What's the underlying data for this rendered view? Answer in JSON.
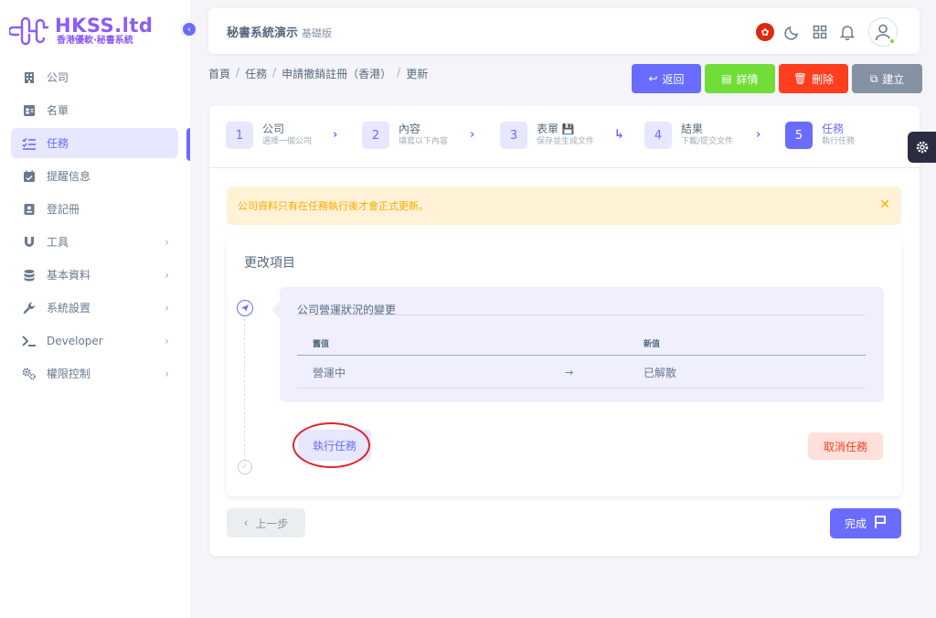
{
  "brand": {
    "name": "HKSS.ltd",
    "subtitle": "香港優軟·秘書系統",
    "accent": "#8b5cf6"
  },
  "sidebar": {
    "items": [
      {
        "label": "公司",
        "icon": "building-icon",
        "has_submenu": false,
        "active": false
      },
      {
        "label": "名單",
        "icon": "contact-card-icon",
        "has_submenu": false,
        "active": false
      },
      {
        "label": "任務",
        "icon": "checklist-icon",
        "has_submenu": false,
        "active": true
      },
      {
        "label": "提醒信息",
        "icon": "calendar-icon",
        "has_submenu": false,
        "active": false
      },
      {
        "label": "登記冊",
        "icon": "register-icon",
        "has_submenu": false,
        "active": false
      },
      {
        "label": "工具",
        "icon": "magnet-icon",
        "has_submenu": true,
        "active": false
      },
      {
        "label": "基本資料",
        "icon": "database-icon",
        "has_submenu": true,
        "active": false
      },
      {
        "label": "系統設置",
        "icon": "wrench-icon",
        "has_submenu": true,
        "active": false
      },
      {
        "label": "Developer",
        "icon": "terminal-icon",
        "has_submenu": true,
        "active": false
      },
      {
        "label": "權限控制",
        "icon": "gears-icon",
        "has_submenu": true,
        "active": false
      }
    ]
  },
  "navbar": {
    "title": "秘書系統演示",
    "edition": "基礎版",
    "flag_symbol": "✿"
  },
  "breadcrumb": [
    "首頁",
    "任務",
    "申請撤銷註冊（香港）",
    "更新"
  ],
  "breadcrumb_sep": "/",
  "actions": {
    "back": "返回",
    "detail": "詳情",
    "delete": "刪除",
    "create": "建立"
  },
  "stepper": {
    "steps": [
      {
        "num": "1",
        "title": "公司",
        "desc": "選擇一個公司"
      },
      {
        "num": "2",
        "title": "內容",
        "desc": "填寫以下內容"
      },
      {
        "num": "3",
        "title": "表單",
        "desc": "保存並生成文件"
      },
      {
        "num": "4",
        "title": "結果",
        "desc": "下載/提交文件"
      },
      {
        "num": "5",
        "title": "任務",
        "desc": "執行任務"
      }
    ],
    "active_step": 5
  },
  "alert": {
    "text": "公司資料只有在任務執行後才會正式更新。",
    "close": "✕"
  },
  "changes": {
    "title": "更改項目",
    "item_title": "公司營運狀況的變更",
    "headers": {
      "old": "舊值",
      "new": "新值"
    },
    "rows": [
      {
        "old": "營運中",
        "arrow": "→",
        "new": "已解散"
      }
    ]
  },
  "task_actions": {
    "run": "執行任務",
    "cancel": "取消任務"
  },
  "nav_buttons": {
    "prev": "上一步",
    "finish": "完成"
  },
  "colors": {
    "primary": "#696cff",
    "success": "#71dd37",
    "danger": "#ff3e1d",
    "secondary": "#8592a3",
    "warning": "#ffab00"
  }
}
